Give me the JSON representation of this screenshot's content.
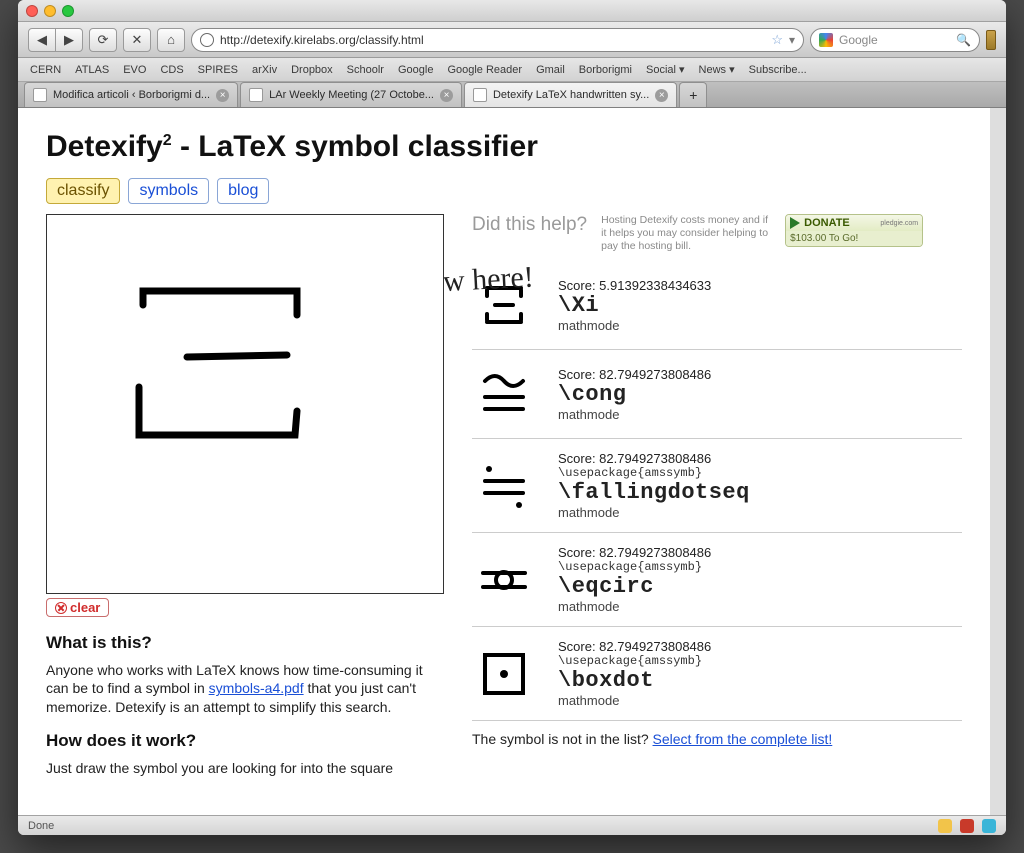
{
  "browser": {
    "url": "http://detexify.kirelabs.org/classify.html",
    "search_placeholder": "Google",
    "status": "Done"
  },
  "bookmarks": [
    "CERN",
    "ATLAS",
    "EVO",
    "CDS",
    "SPIRES",
    "arXiv",
    "Dropbox",
    "Schoolr",
    "Google",
    "Google Reader",
    "Gmail",
    "Borborigmi",
    "Social ▾",
    "News ▾",
    "Subscribe..."
  ],
  "tabs": [
    {
      "label": "Modifica articoli ‹ Borborigmi d...",
      "active": false
    },
    {
      "label": "LAr Weekly Meeting (27 Octobe...",
      "active": false
    },
    {
      "label": "Detexify LaTeX handwritten sy...",
      "active": true
    }
  ],
  "page": {
    "title_a": "Detexify",
    "title_sup": "2",
    "title_b": " - LaTeX symbol classifier",
    "nav": [
      {
        "label": "classify",
        "active": true
      },
      {
        "label": "symbols",
        "active": false
      },
      {
        "label": "blog",
        "active": false
      }
    ],
    "handwritten": "Draw here!",
    "clear_label": "clear",
    "whatis_h": "What is this?",
    "whatis_p1": "Anyone who works with LaTeX knows how time-consuming it can be to find a symbol in ",
    "whatis_link": "symbols-a4.pdf",
    "whatis_p2": " that you just can't memorize. Detexify is an attempt to simplify this search.",
    "howworks_h": "How does it work?",
    "howworks_p": "Just draw the symbol you are looking for into the square",
    "help_q": "Did this help?",
    "help_note": "Hosting Detexify costs money and if it helps you may consider helping to pay the hosting bill.",
    "donate_label": "DONATE",
    "donate_site": "pledgie.com",
    "donate_amount": "$103.00 To Go!",
    "notlist_a": "The symbol is not in the list? ",
    "notlist_link": "Select from the complete list!"
  },
  "results": [
    {
      "score": "5.91392338434633",
      "pkg": "",
      "cmd": "\\Xi",
      "mode": "mathmode",
      "sym": "xi"
    },
    {
      "score": "82.7949273808486",
      "pkg": "",
      "cmd": "\\cong",
      "mode": "mathmode",
      "sym": "cong"
    },
    {
      "score": "82.7949273808486",
      "pkg": "\\usepackage{amssymb}",
      "cmd": "\\fallingdotseq",
      "mode": "mathmode",
      "sym": "fallingdotseq"
    },
    {
      "score": "82.7949273808486",
      "pkg": "\\usepackage{amssymb}",
      "cmd": "\\eqcirc",
      "mode": "mathmode",
      "sym": "eqcirc"
    },
    {
      "score": "82.7949273808486",
      "pkg": "\\usepackage{amssymb}",
      "cmd": "\\boxdot",
      "mode": "mathmode",
      "sym": "boxdot"
    }
  ]
}
